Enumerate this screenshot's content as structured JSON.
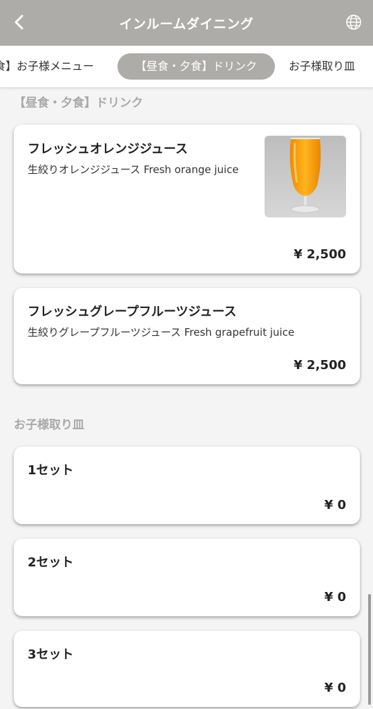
{
  "header": {
    "title": "インルームダイニング",
    "back_icon": "chevron-left-icon",
    "language_icon": "globe-icon"
  },
  "tabs": [
    {
      "label": "食】お子様メニュー",
      "active": false
    },
    {
      "label": "【昼食・夕食】ドリンク",
      "active": true
    },
    {
      "label": "お子様取り皿",
      "active": false
    }
  ],
  "sections": [
    {
      "title": "【昼食・夕食】ドリンク",
      "items": [
        {
          "name": "フレッシュオレンジジュース",
          "description": "生絞りオレンジジュース  Fresh orange juice",
          "price": "¥ 2,500",
          "image": "orange-juice-photo"
        },
        {
          "name": "フレッシュグレープフルーツジュース",
          "description": "生絞りグレープフルーツジュース  Fresh grapefruit juice",
          "price": "¥ 2,500"
        }
      ]
    },
    {
      "title": "お子様取り皿",
      "items": [
        {
          "name": "1セット",
          "price": "¥ 0"
        },
        {
          "name": "2セット",
          "price": "¥ 0"
        },
        {
          "name": "3セット",
          "price": "¥ 0"
        }
      ]
    }
  ],
  "colors": {
    "header_bg": "#adaca8",
    "active_tab_bg": "#adaca8",
    "page_bg": "#f4f4f4",
    "section_title": "#a9a9a9"
  }
}
